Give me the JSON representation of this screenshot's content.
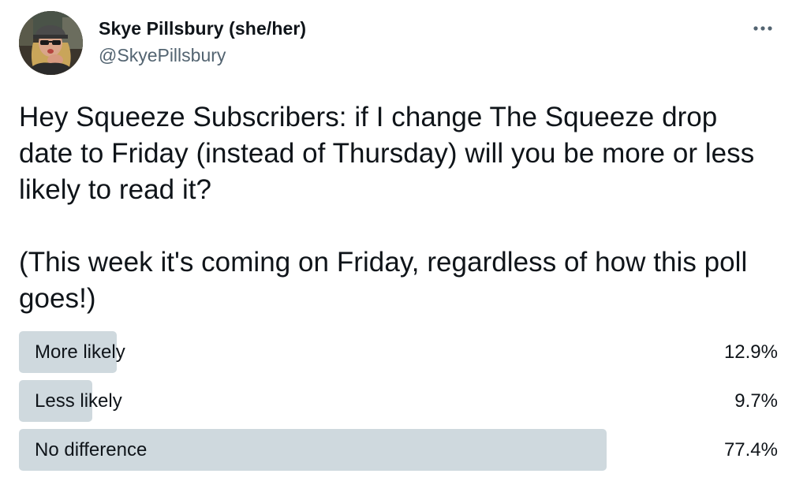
{
  "author": {
    "name": "Skye Pillsbury (she/her)",
    "handle": "@SkyePillsbury",
    "avatar_icon": "profile-photo-icon"
  },
  "menu": {
    "icon": "more-horizontal-icon"
  },
  "tweet": {
    "text": "Hey Squeeze Subscribers: if I change The Squeeze drop date to Friday (instead of Thursday) will you be more or less likely to read it?\n\n(This week it's coming on Friday, regardless of how this poll goes!)"
  },
  "poll": {
    "bar_color": "#cfd9de",
    "options": [
      {
        "label": "More likely",
        "percent_label": "12.9%",
        "percent": 12.9
      },
      {
        "label": "Less likely",
        "percent_label": "9.7%",
        "percent": 9.7
      },
      {
        "label": "No difference",
        "percent_label": "77.4%",
        "percent": 77.4
      }
    ]
  }
}
